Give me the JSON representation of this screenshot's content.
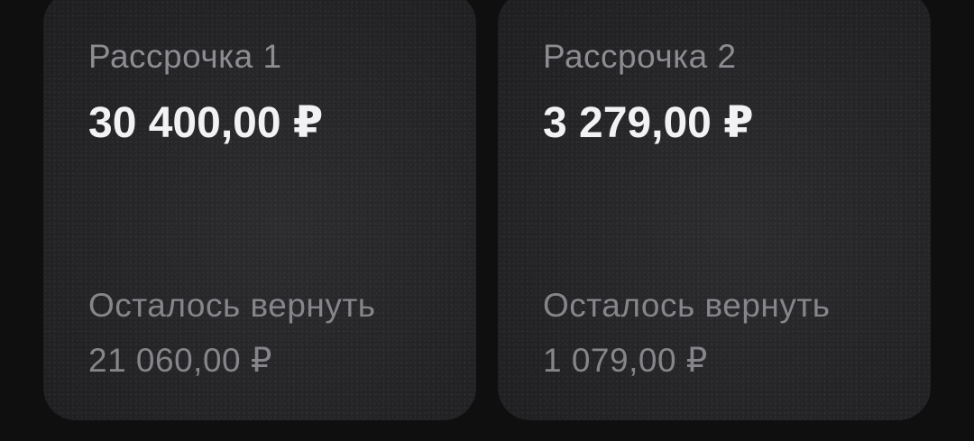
{
  "installments": [
    {
      "title": "Рассрочка 1",
      "amount": "30 400,00 ₽",
      "remaining_label": "Осталось вернуть",
      "remaining_value": "21 060,00 ₽"
    },
    {
      "title": "Рассрочка 2",
      "amount": "3 279,00 ₽",
      "remaining_label": "Осталось вернуть",
      "remaining_value": "1 079,00 ₽"
    }
  ],
  "colors": {
    "page_background": "#0f0f10",
    "card_background": "#262628",
    "primary_text": "#f2f2f4",
    "secondary_text": "#8c8c91"
  }
}
